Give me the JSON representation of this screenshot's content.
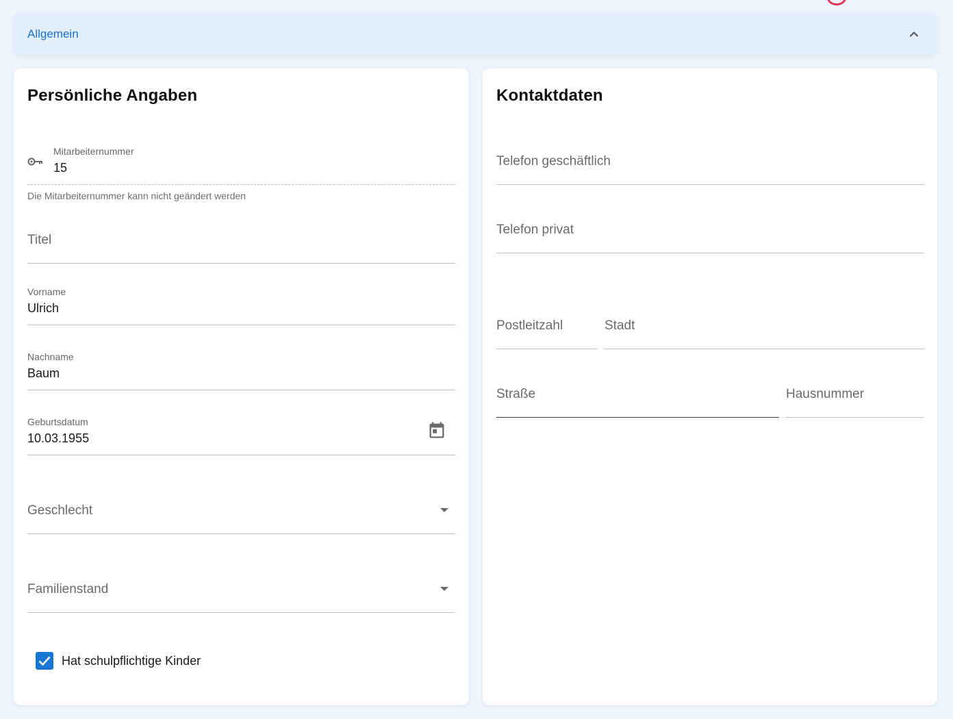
{
  "accordion": {
    "title": "Allgemein",
    "expanded": true
  },
  "personal": {
    "title": "Persönliche Angaben",
    "employee_number": {
      "label": "Mitarbeiternummer",
      "value": "15",
      "hint": "Die Mitarbeiternummer kann nicht geändert werden",
      "icon": "key-icon"
    },
    "title_field": {
      "placeholder": "Titel"
    },
    "first_name": {
      "label": "Vorname",
      "value": "Ulrich"
    },
    "last_name": {
      "label": "Nachname",
      "value": "Baum"
    },
    "birth_date": {
      "label": "Geburtsdatum",
      "value": "10.03.1955",
      "icon": "calendar-icon"
    },
    "gender": {
      "placeholder": "Geschlecht"
    },
    "marital_status": {
      "placeholder": "Familienstand"
    },
    "school_children": {
      "label": "Hat schulpflichtige Kinder",
      "checked": true
    }
  },
  "contact": {
    "title": "Kontaktdaten",
    "phone_business": {
      "placeholder": "Telefon geschäftlich"
    },
    "phone_private": {
      "placeholder": "Telefon privat"
    },
    "postal_code": {
      "placeholder": "Postleitzahl"
    },
    "city": {
      "placeholder": "Stadt"
    },
    "street": {
      "placeholder": "Straße"
    },
    "house_number": {
      "placeholder": "Hausnummer"
    }
  },
  "colors": {
    "accent": "#1976d2",
    "background": "#eef4fc",
    "header": "#e2eefc"
  }
}
